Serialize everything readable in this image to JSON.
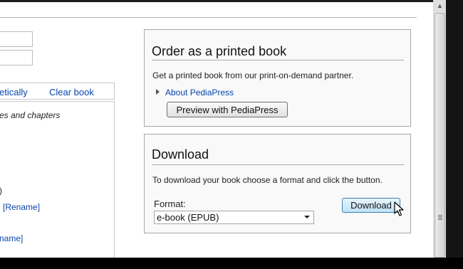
{
  "left_panel": {
    "sort_link": "etically",
    "clear_link": "Clear book",
    "chapters_text": "es and chapters",
    "paren_text": ")",
    "rename_link_1": "[Rename]",
    "rename_link_2": "name]"
  },
  "order_panel": {
    "title": "Order as a printed book",
    "description": "Get a printed book from our print-on-demand partner.",
    "about_link": "About PediaPress",
    "preview_button": "Preview with PediaPress"
  },
  "download_panel": {
    "title": "Download",
    "description": "To download your book choose a format and click the button.",
    "format_label": "Format:",
    "format_selected": "e-book (EPUB)",
    "download_button": "Download"
  },
  "colors": {
    "link": "#0645ad",
    "panel_bg": "#f9f9f9",
    "download_button_bg": "#bfe2f6"
  },
  "icons": {
    "expand": "triangle-right-icon",
    "dropdown": "chevron-down-icon",
    "pointer": "mouse-pointer-icon"
  }
}
